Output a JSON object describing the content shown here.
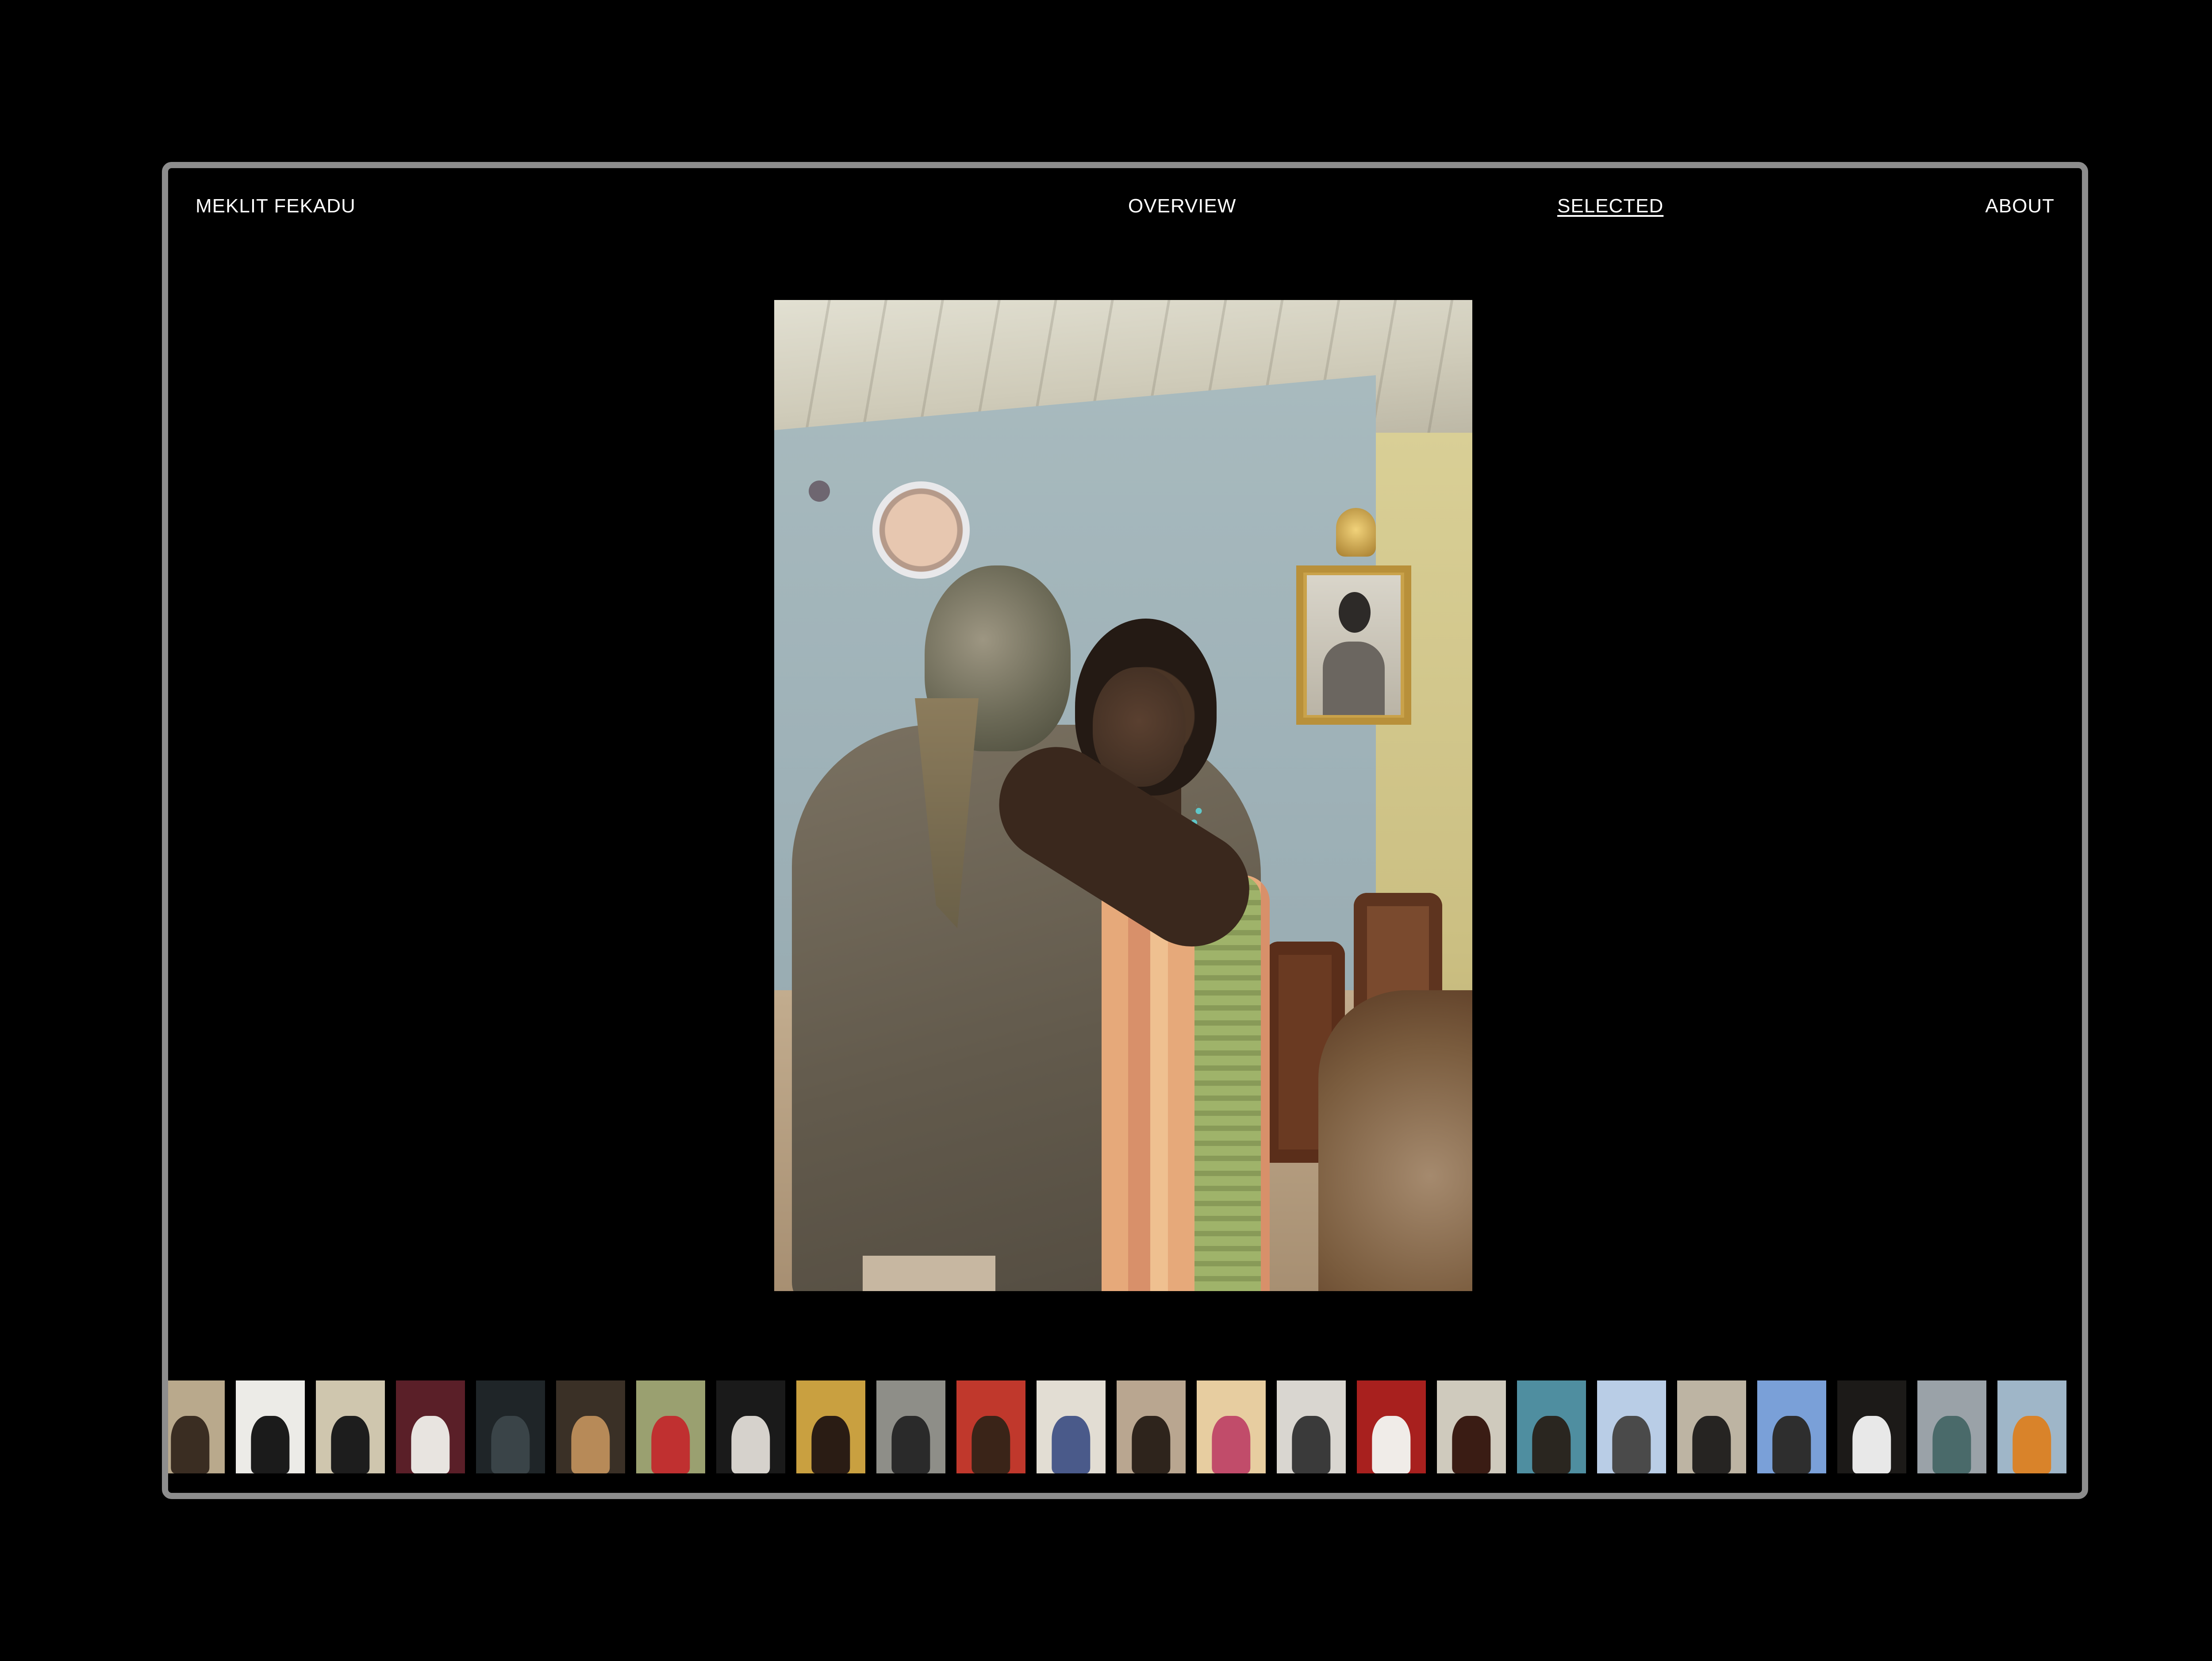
{
  "nav": {
    "brand": "MEKLIT FEKADU",
    "overview": "OVERVIEW",
    "selected": "SELECTED",
    "about": "ABOUT",
    "active": "selected"
  },
  "colors": {
    "background": "#000000",
    "frame_border": "#8d8d8d",
    "nav_text": "#ffffff"
  },
  "main_image": {
    "description_name": "embracing-couple-photo"
  },
  "thumbnails": [
    {
      "name": "thumb-01",
      "bg": "#b9a98c",
      "fg": "#3a2d22"
    },
    {
      "name": "thumb-02",
      "bg": "#ecebe7",
      "fg": "#1b1b1b"
    },
    {
      "name": "thumb-03",
      "bg": "#cfc6ae",
      "fg": "#1d1d1d"
    },
    {
      "name": "thumb-04",
      "bg": "#5a1f28",
      "fg": "#e8e4e0"
    },
    {
      "name": "thumb-05",
      "bg": "#1f2528",
      "fg": "#3a4448"
    },
    {
      "name": "thumb-06",
      "bg": "#3a3026",
      "fg": "#b78a58"
    },
    {
      "name": "thumb-07",
      "bg": "#9aa070",
      "fg": "#c03030"
    },
    {
      "name": "thumb-08",
      "bg": "#1a1a1a",
      "fg": "#d6d2cc"
    },
    {
      "name": "thumb-09",
      "bg": "#c9a040",
      "fg": "#2a1c14"
    },
    {
      "name": "thumb-10",
      "bg": "#8e8e88",
      "fg": "#2a2a2a"
    },
    {
      "name": "thumb-11",
      "bg": "#c0382c",
      "fg": "#3a2418"
    },
    {
      "name": "thumb-12",
      "bg": "#e2ddd3",
      "fg": "#4a5a8a"
    },
    {
      "name": "thumb-13",
      "bg": "#b9a690",
      "fg": "#2e241c"
    },
    {
      "name": "thumb-14",
      "bg": "#e7cda0",
      "fg": "#c14c6a"
    },
    {
      "name": "thumb-15",
      "bg": "#d9d6d0",
      "fg": "#3a3a3a"
    },
    {
      "name": "thumb-16",
      "bg": "#a8201e",
      "fg": "#f0ece8"
    },
    {
      "name": "thumb-17",
      "bg": "#cfcabd",
      "fg": "#3a1c14"
    },
    {
      "name": "thumb-18",
      "bg": "#4f8ea0",
      "fg": "#2a2620"
    },
    {
      "name": "thumb-19",
      "bg": "#b9cde6",
      "fg": "#4a4a4a"
    },
    {
      "name": "thumb-20",
      "bg": "#bdb4a3",
      "fg": "#262422"
    },
    {
      "name": "thumb-21",
      "bg": "#7aa0d8",
      "fg": "#2e2e2e"
    },
    {
      "name": "thumb-22",
      "bg": "#1c1a18",
      "fg": "#e8e8e8"
    },
    {
      "name": "thumb-23",
      "bg": "#9aa2a8",
      "fg": "#4a6a6a"
    },
    {
      "name": "thumb-24",
      "bg": "#9fb6c8",
      "fg": "#d9832a"
    }
  ]
}
